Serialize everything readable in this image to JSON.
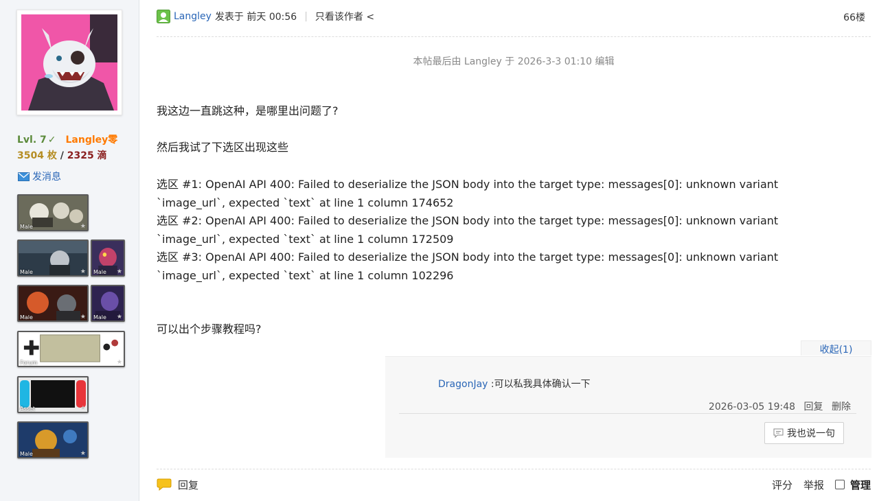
{
  "user": {
    "level": "Lvl. 7",
    "check": "✓",
    "name": "Langley零",
    "coins": "3504 枚",
    "slash": "/",
    "drops": "2325 滴",
    "message_link": "发消息"
  },
  "medals": [
    {
      "caption": "Male"
    },
    {
      "caption": "Male"
    },
    {
      "caption": "Male"
    },
    {
      "caption": "Male"
    },
    {
      "caption": "Male"
    },
    {
      "caption": "Forum"
    },
    {
      "caption": "Asset"
    },
    {
      "caption": "Male"
    }
  ],
  "post": {
    "author": "Langley",
    "posted_label": "发表于 前天 00:56",
    "separator": "|",
    "only_author": "只看该作者 <",
    "floor": "66楼",
    "edit_note": "本帖最后由 Langley 于 2026-3-3 01:10 编辑",
    "paragraphs": [
      "我这边一直跳这种，是哪里出问题了?",
      "然后我试了下选区出现这些",
      "选区 #1: OpenAI API 400: Failed to deserialize the JSON body into the target type: messages[0]: unknown variant `image_url`, expected `text` at line 1 column 174652\n选区 #2: OpenAI API 400: Failed to deserialize the JSON body into the target type: messages[0]: unknown variant `image_url`, expected `text` at line 1 column 172509\n选区 #3: OpenAI API 400: Failed to deserialize the JSON body into the target type: messages[0]: unknown variant `image_url`, expected `text` at line 1 column 102296",
      "可以出个步骤教程吗?"
    ]
  },
  "comments": {
    "collapse_label": "收起(1)",
    "items": [
      {
        "user": "DragonJay",
        "text": " :可以私我具体确认一下",
        "time": "2026-03-05 19:48",
        "reply": "回复",
        "delete": "删除"
      }
    ],
    "say_button": "我也说一句"
  },
  "footer": {
    "reply": "回复",
    "rate": "评分",
    "report": "举报",
    "manage": "管理"
  },
  "colors": {
    "link": "#2a66b7",
    "username": "#ff7a00",
    "level": "#5b8a3a",
    "coins": "#b58d23",
    "drops": "#8a1f1f"
  },
  "icons": {
    "online": "user-online-icon",
    "message": "envelope-icon",
    "comment": "speech-bubble-icon",
    "reply": "reply-bubble-icon"
  }
}
